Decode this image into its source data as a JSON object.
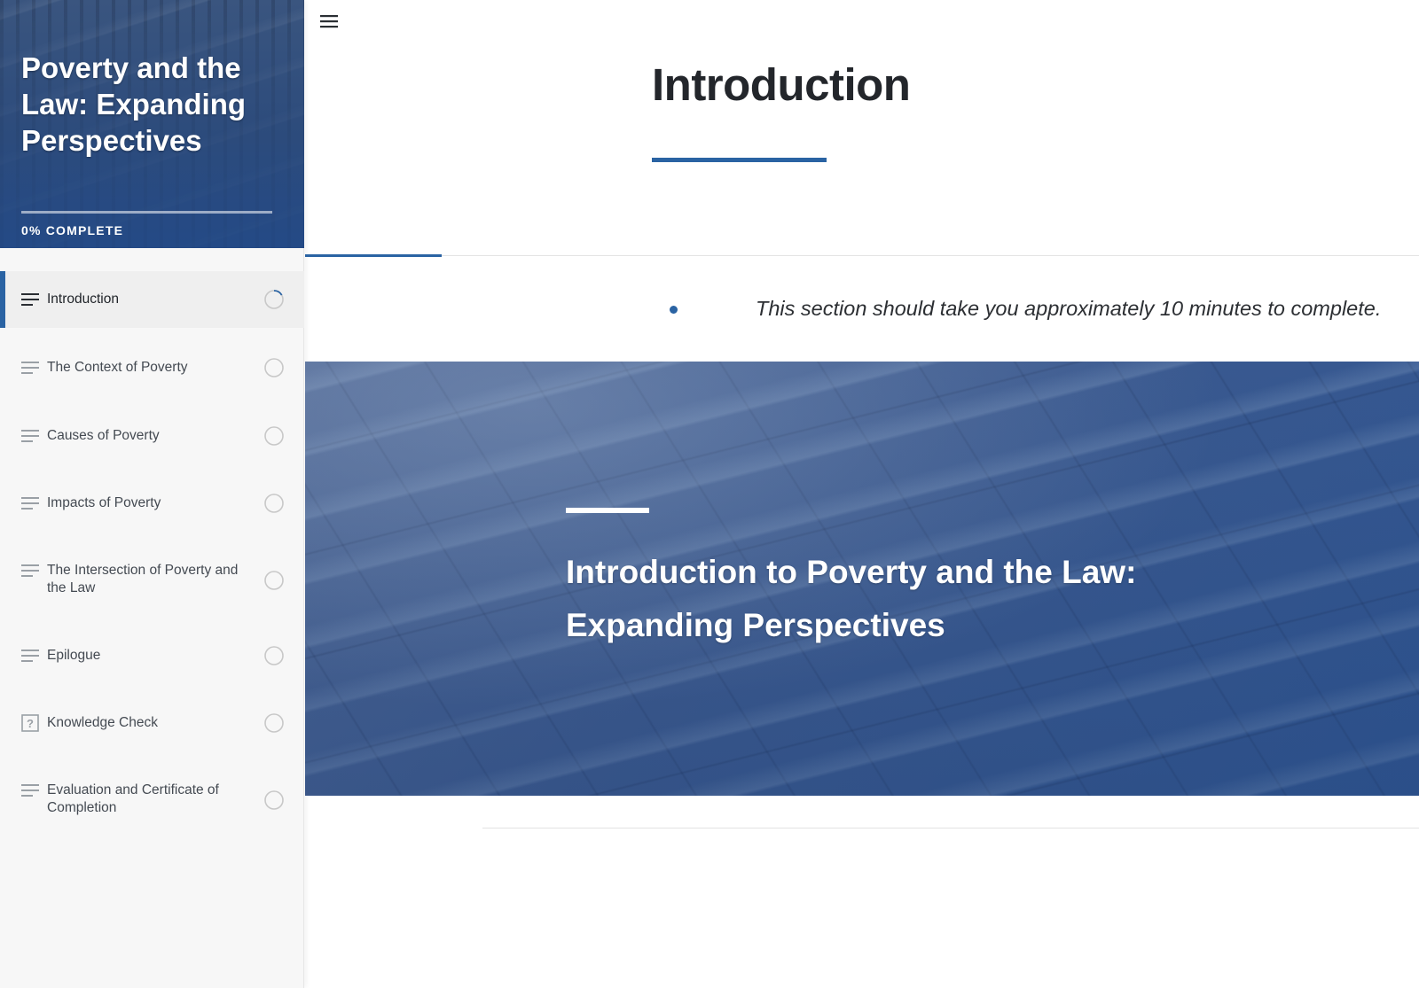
{
  "course": {
    "title": "Poverty and the Law: Expanding Perspectives",
    "progress_percent": 0,
    "progress_label": "0% COMPLETE"
  },
  "sidebar": {
    "items": [
      {
        "label": "Introduction",
        "icon": "lesson-text-icon",
        "status": "in-progress",
        "active": true
      },
      {
        "label": "The Context of Poverty",
        "icon": "lesson-text-icon",
        "status": "not-started",
        "active": false
      },
      {
        "label": "Causes of Poverty",
        "icon": "lesson-text-icon",
        "status": "not-started",
        "active": false
      },
      {
        "label": "Impacts of Poverty",
        "icon": "lesson-text-icon",
        "status": "not-started",
        "active": false
      },
      {
        "label": "The Intersection of Poverty and the Law",
        "icon": "lesson-text-icon",
        "status": "not-started",
        "active": false
      },
      {
        "label": "Epilogue",
        "icon": "lesson-text-icon",
        "status": "not-started",
        "active": false
      },
      {
        "label": "Knowledge Check",
        "icon": "quiz-question-icon",
        "status": "not-started",
        "active": false
      },
      {
        "label": "Evaluation and Certificate of Completion",
        "icon": "lesson-text-icon",
        "status": "not-started",
        "active": false
      }
    ]
  },
  "main": {
    "menu_icon": "hamburger-menu-icon",
    "lesson_title": "Introduction",
    "duration_note": "This section should take you approximately 10 minutes to complete.",
    "banner_heading": "Introduction to Poverty and the Law: Expanding Perspectives"
  },
  "colors": {
    "accent": "#2a63a3",
    "header_bg": "#2c4b7c",
    "sidebar_bg": "#f7f7f7",
    "text_dark": "#23262b"
  }
}
